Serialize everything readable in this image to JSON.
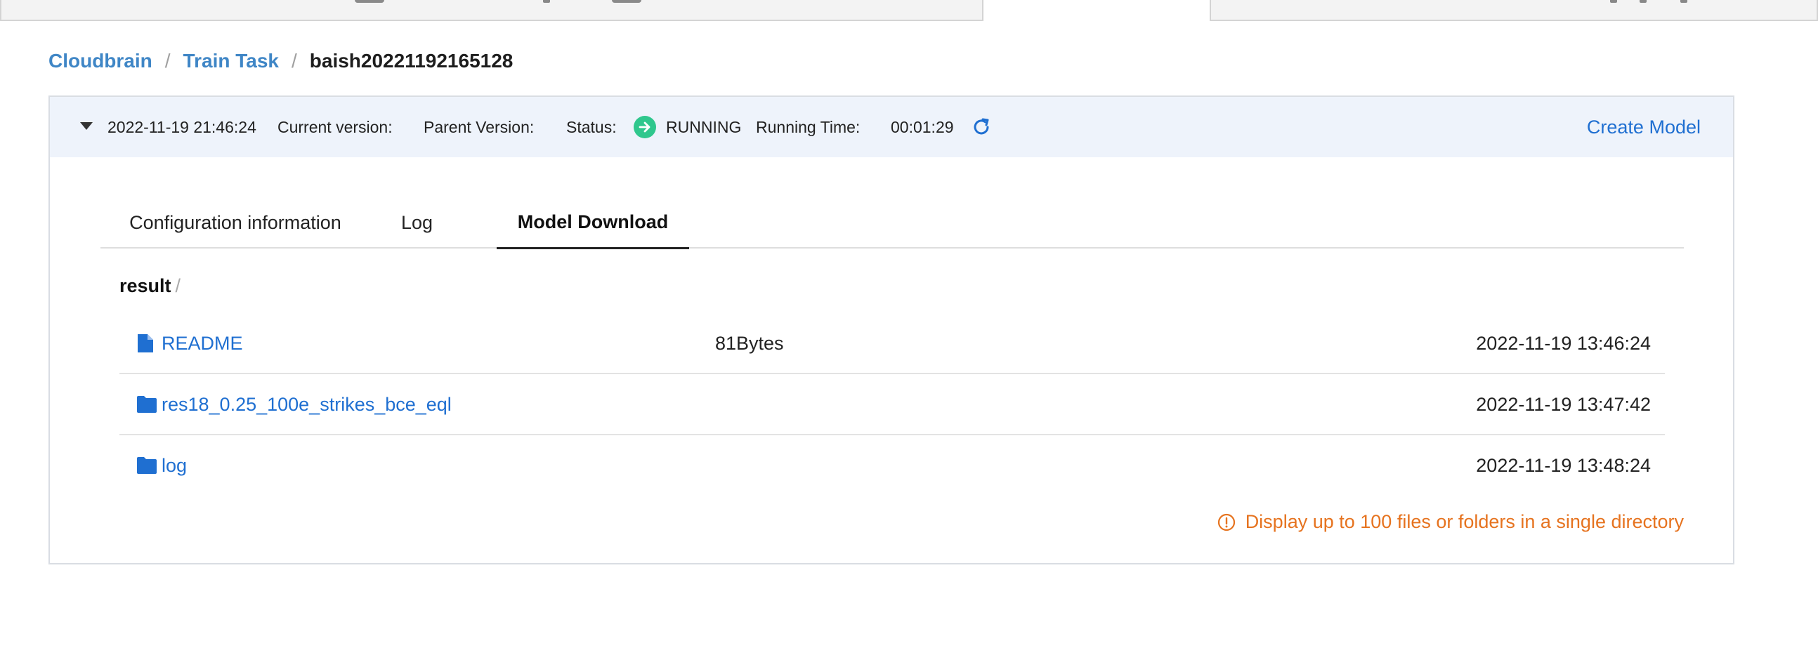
{
  "breadcrumb": {
    "root": "Cloudbrain",
    "section": "Train Task",
    "current": "baish20221192165128",
    "separator": "/"
  },
  "header": {
    "timestamp": "2022-11-19 21:46:24",
    "current_version_label": "Current version:",
    "parent_version_label": "Parent Version:",
    "status_label": "Status:",
    "status_value": "RUNNING",
    "running_time_label": "Running Time:",
    "running_time_value": "00:01:29",
    "create_model_label": "Create Model"
  },
  "tabs": [
    {
      "label": "Configuration information"
    },
    {
      "label": "Log"
    },
    {
      "label": "Model Download"
    }
  ],
  "active_tab": "Model Download",
  "path": {
    "root": "result",
    "separator": "/"
  },
  "files": [
    {
      "name": "README",
      "type": "file",
      "size": "81Bytes",
      "modified": "2022-11-19 13:46:24"
    },
    {
      "name": "res18_0.25_100e_strikes_bce_eql",
      "type": "folder",
      "size": "",
      "modified": "2022-11-19 13:47:42"
    },
    {
      "name": "log",
      "type": "folder",
      "size": "",
      "modified": "2022-11-19 13:48:24"
    }
  ],
  "notice": "Display up to 100 files or folders in a single directory",
  "colors": {
    "link": "#1f6fd1",
    "breadcrumb_link": "#3f86c6",
    "status_running": "#2fc78d",
    "notice": "#e6731f",
    "header_bg": "#eef3fb"
  }
}
